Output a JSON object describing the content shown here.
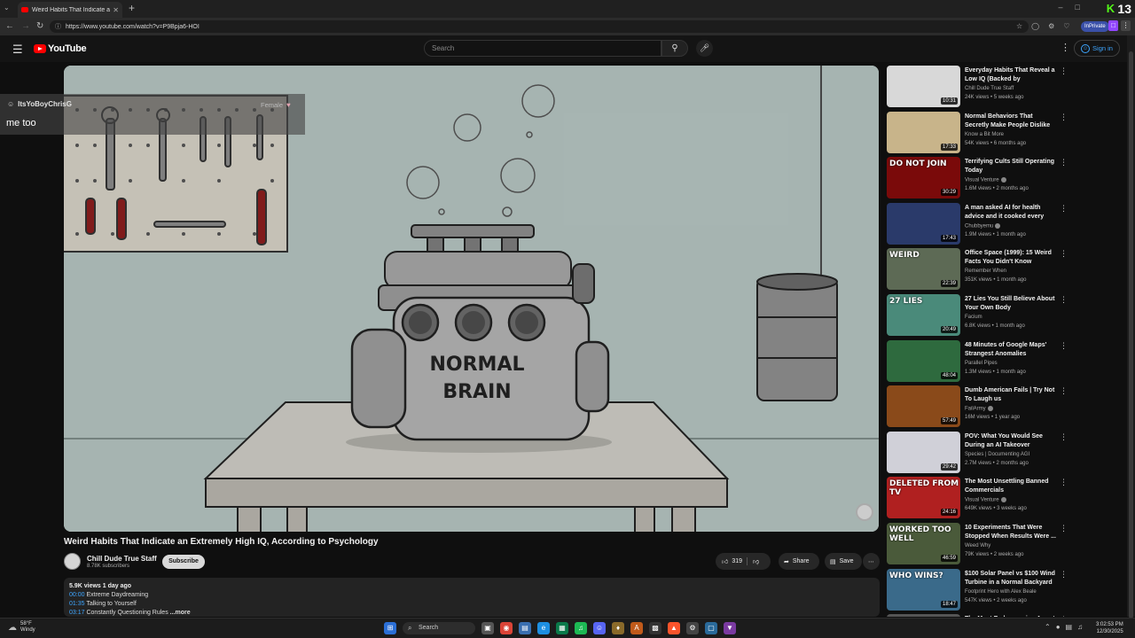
{
  "browser": {
    "tab_title": "Weird Habits That Indicate an Extr",
    "url": "https://www.youtube.com/watch?v=P9Bpja6-HOI",
    "inprivate_label": "InPrivate",
    "kick_counter": "13"
  },
  "header": {
    "logo_text": "YouTube",
    "search_placeholder": "Search",
    "signin_label": "Sign in"
  },
  "player": {
    "scene_text_line1": "NORMAL",
    "scene_text_line2": "BRAIN"
  },
  "chat_overlay": {
    "username": "ItsYoBoyChrisG",
    "tag": "Female",
    "message": "me too"
  },
  "video": {
    "title": "Weird Habits That Indicate an Extremely High IQ, According to Psychology",
    "channel": "Chill Dude True Staff",
    "subscribers": "8.78K subscribers",
    "subscribe_label": "Subscribe",
    "likes": "319",
    "share_label": "Share",
    "save_label": "Save"
  },
  "description": {
    "meta": "5.9K views  1 day ago",
    "chapters": [
      {
        "time": "00:00",
        "label": "Extreme Daydreaming"
      },
      {
        "time": "01:35",
        "label": "Talking to Yourself"
      },
      {
        "time": "03:17",
        "label": "Constantly Questioning Rules"
      }
    ],
    "more_label": "...more"
  },
  "recommendations": [
    {
      "title": "Everyday Habits That Reveal a Low IQ (Backed by Psychology)",
      "channel": "Chill Dude True Staff",
      "meta": "24K views • 5 weeks ago",
      "duration": "10:31",
      "thumb_text": "",
      "thumb_color": "#d8d8d8",
      "verified": false
    },
    {
      "title": "Normal Behaviors That Secretly Make People Dislike You",
      "channel": "Know a Bit More",
      "meta": "54K views • 6 months ago",
      "duration": "17:33",
      "thumb_text": "",
      "thumb_color": "#c8b48a",
      "verified": false
    },
    {
      "title": "Terrifying Cults Still Operating Today",
      "channel": "Visual Venture",
      "meta": "1.6M views • 2 months ago",
      "duration": "30:29",
      "thumb_text": "DO NOT JOIN",
      "thumb_color": "#7a0a0a",
      "verified": true
    },
    {
      "title": "A man asked AI for health advice and it cooked every bra...",
      "channel": "Chubbyemu",
      "meta": "1.9M views • 1 month ago",
      "duration": "17:43",
      "thumb_text": "",
      "thumb_color": "#2a3a6a",
      "verified": true
    },
    {
      "title": "Office Space (1999): 15 Weird Facts You Didn't Know",
      "channel": "Remember When",
      "meta": "351K views • 1 month ago",
      "duration": "22:39",
      "thumb_text": "WEIRD",
      "thumb_color": "#5d6a55",
      "verified": false
    },
    {
      "title": "27 Lies You Still Believe About Your Own Body",
      "channel": "Facium",
      "meta": "6.8K views • 1 month ago",
      "duration": "20:49",
      "thumb_text": "27 LIES",
      "thumb_color": "#4a8a7a",
      "verified": false
    },
    {
      "title": "48 Minutes of Google Maps' Strangest Anomalies",
      "channel": "Parallel Pipes",
      "meta": "1.3M views • 1 month ago",
      "duration": "48:04",
      "thumb_text": "",
      "thumb_color": "#2e6a3e",
      "verified": false
    },
    {
      "title": "Dumb American Fails | Try Not To Laugh us",
      "channel": "FailArmy",
      "meta": "16M views • 1 year ago",
      "duration": "57:49",
      "thumb_text": "",
      "thumb_color": "#8a4a1a",
      "verified": true
    },
    {
      "title": "POV: What You Would See During an AI Takeover",
      "channel": "Species | Documenting AGI",
      "meta": "2.7M views • 2 months ago",
      "duration": "29:42",
      "thumb_text": "",
      "thumb_color": "#d0d0d8",
      "verified": false
    },
    {
      "title": "The Most Unsettling Banned Commercials",
      "channel": "Visual Venture",
      "meta": "649K views • 3 weeks ago",
      "duration": "24:16",
      "thumb_text": "DELETED FROM TV",
      "thumb_color": "#b02020",
      "verified": true
    },
    {
      "title": "10 Experiments That Were Stopped When Results Were ...",
      "channel": "Weed Why",
      "meta": "79K views • 2 weeks ago",
      "duration": "46:59",
      "thumb_text": "WORKED TOO WELL",
      "thumb_color": "#4a5a3a",
      "verified": false
    },
    {
      "title": "$100 Solar Panel vs $100 Wind Turbine in a Normal Backyard",
      "channel": "Footprint Hero with Alex Beale",
      "meta": "547K views • 2 weeks ago",
      "duration": "18:47",
      "thumb_text": "WHO WINS?",
      "thumb_color": "#3a6a8a",
      "verified": false
    },
    {
      "title": "The Most Embarrassing Arrest",
      "channel": "",
      "meta": "",
      "duration": "",
      "thumb_text": "",
      "thumb_color": "#555555",
      "verified": false
    }
  ],
  "taskbar": {
    "temperature": "58°F",
    "condition": "Windy",
    "search_label": "Search",
    "time": "3:02:53 PM",
    "date": "12/30/2025"
  },
  "colors": {
    "accent_blue": "#3ea6ff",
    "youtube_red": "#ff0000",
    "kick_green": "#53fc18"
  }
}
